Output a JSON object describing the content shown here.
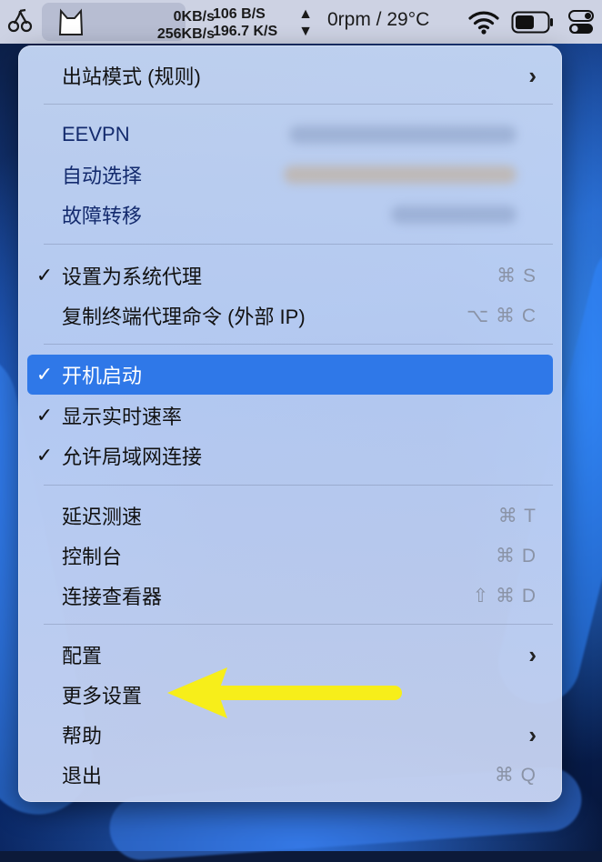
{
  "menubar": {
    "upload_speed": "0KB/s",
    "download_speed": "256KB/s",
    "sent_rate": "106 B/S",
    "recv_rate": "196.7 K/S",
    "fan_temp": "0rpm / 29°C",
    "icons": [
      "cherry-icon",
      "cat-app-icon",
      "wifi-icon",
      "battery-icon",
      "control-center-icon"
    ]
  },
  "menu": {
    "outbound_mode": "出站模式 (规则)",
    "proxy_groups": [
      "EEVPN",
      "自动选择",
      "故障转移"
    ],
    "set_system_proxy": "设置为系统代理",
    "set_system_proxy_shortcut": "⌘ S",
    "copy_terminal_cmd": "复制终端代理命令 (外部 IP)",
    "copy_terminal_cmd_shortcut": "⌥ ⌘ C",
    "launch_at_login": "开机启动",
    "show_speed": "显示实时速率",
    "allow_lan": "允许局域网连接",
    "latency_test": "延迟测速",
    "latency_test_shortcut": "⌘ T",
    "dashboard": "控制台",
    "dashboard_shortcut": "⌘ D",
    "conn_viewer": "连接查看器",
    "conn_viewer_shortcut": "⇧ ⌘ D",
    "config": "配置",
    "more_settings": "更多设置",
    "help": "帮助",
    "quit": "退出",
    "quit_shortcut": "⌘ Q",
    "checkmark": "✓",
    "chevron": "›"
  },
  "colors": {
    "highlight": "#2f78e8",
    "arrow": "#f7ee1a"
  }
}
